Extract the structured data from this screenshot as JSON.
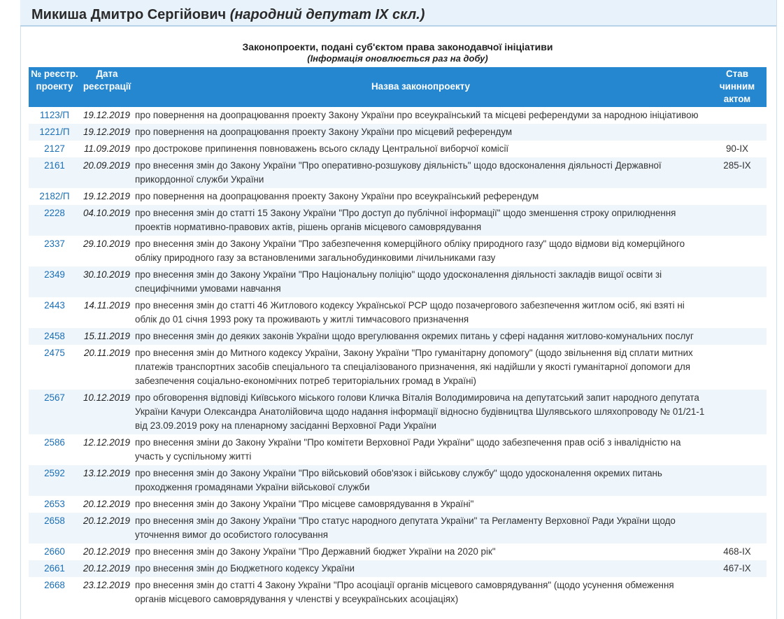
{
  "header": {
    "name": "Микиша Дмитро Сергійович",
    "role": "(народний депутат IX скл.)"
  },
  "caption": {
    "title": "Законопроекти, подані суб'єктом права законодавчої ініціативи",
    "subtitle": "(Інформація оновлюється раз на добу)"
  },
  "table": {
    "headers": {
      "number": "№ реєстр. проекту",
      "date": "Дата реєстрації",
      "title": "Назва законопроекту",
      "act": "Став чинним актом"
    },
    "rows": [
      {
        "number": "1123/П",
        "date": "19.12.2019",
        "title": "про повернення на доопрацювання проекту Закону України про всеукраїнський та місцеві референдуми за народною ініціативою",
        "act": ""
      },
      {
        "number": "1221/П",
        "date": "19.12.2019",
        "title": "про повернення на доопрацювання проекту Закону України про місцевий референдум",
        "act": ""
      },
      {
        "number": "2127",
        "date": "11.09.2019",
        "title": "про дострокове припинення повноважень всього складу Центральної виборчої комісії",
        "act": "90-IX"
      },
      {
        "number": "2161",
        "date": "20.09.2019",
        "title": "про внесення змін до Закону України \"Про оперативно-розшукову діяльність\" щодо вдосконалення діяльності Державної прикордонної служби України",
        "act": "285-IX"
      },
      {
        "number": "2182/П",
        "date": "19.12.2019",
        "title": "про повернення на доопрацювання проекту Закону України про всеукраїнський референдум",
        "act": ""
      },
      {
        "number": "2228",
        "date": "04.10.2019",
        "title": "про внесення змін до статті 15 Закону України \"Про доступ до публічної інформації\" щодо зменшення строку оприлюднення проектів нормативно-правових актів, рішень органів місцевого самоврядування",
        "act": ""
      },
      {
        "number": "2337",
        "date": "29.10.2019",
        "title": "про внесення змін до Закону України \"Про забезпечення комерційного обліку природного газу\" щодо відмови від комерційного обліку природного газу за встановленими загальнобудинковими лічильниками газу",
        "act": ""
      },
      {
        "number": "2349",
        "date": "30.10.2019",
        "title": "про внесення змін до Закону України \"Про Національну поліцію\" щодо удосконалення діяльності закладів вищої освіти зі специфічними умовами навчання",
        "act": ""
      },
      {
        "number": "2443",
        "date": "14.11.2019",
        "title": "про внесення змін до статті 46 Житлового кодексу Української РСР щодо позачергового забезпечення житлом осіб, які взяті ні облік до 01 січня 1993 року та проживають у житлі тимчасового призначення",
        "act": ""
      },
      {
        "number": "2458",
        "date": "15.11.2019",
        "title": "про внесення змін до деяких законів України щодо врегулювання окремих питань у сфері надання житлово-комунальних послуг",
        "act": ""
      },
      {
        "number": "2475",
        "date": "20.11.2019",
        "title": "про внесення змін до Митного кодексу України, Закону України \"Про гуманітарну допомогу\" (щодо звільнення від сплати митних платежів транспортних засобів спеціального та спеціалізованого призначення, які надійшли у якості гуманітарної допомоги для забезпечення соціально-економічних потреб територіальних громад в Україні)",
        "act": ""
      },
      {
        "number": "2567",
        "date": "10.12.2019",
        "title": "про обговорення відповіді Київського міського голови Кличка Віталія Володимировича на депутатський запит народного депутата України Качури Олександра Анатолійовича щодо надання інформації відносно будівництва Шулявського шляхопроводу № 01/21-1 від 23.09.2019 року на пленарному засіданні Верховної Ради України",
        "act": ""
      },
      {
        "number": "2586",
        "date": "12.12.2019",
        "title": "про внесення зміни до Закону України \"Про комітети Верховної Ради України\" щодо забезпечення прав осіб з інвалідністю на участь у суспільному житті",
        "act": ""
      },
      {
        "number": "2592",
        "date": "13.12.2019",
        "title": "про внесення змін до Закону України \"Про військовий обов'язок і військову службу\" щодо удосконалення окремих питань проходження громадянами України військової служби",
        "act": ""
      },
      {
        "number": "2653",
        "date": "20.12.2019",
        "title": "про внесення змін до Закону України \"Про місцеве самоврядування в Україні\"",
        "act": ""
      },
      {
        "number": "2658",
        "date": "20.12.2019",
        "title": "про внесення змін до Закону України \"Про статус народного депутата України\" та Регламенту Верховної Ради України щодо уточнення вимог до особистого голосування",
        "act": ""
      },
      {
        "number": "2660",
        "date": "20.12.2019",
        "title": "про внесення змін до Закону України \"Про Державний бюджет України на 2020 рік\"",
        "act": "468-IX"
      },
      {
        "number": "2661",
        "date": "20.12.2019",
        "title": "про внесення змін до Бюджетного кодексу України",
        "act": "467-IX"
      },
      {
        "number": "2668",
        "date": "23.12.2019",
        "title": "про внесення змін до статті 4 Закону України \"Про асоціації органів місцевого самоврядування\" (щодо усунення обмеження органів місцевого самоврядування у членстві у всеукраїнських асоціаціях)",
        "act": ""
      }
    ]
  }
}
